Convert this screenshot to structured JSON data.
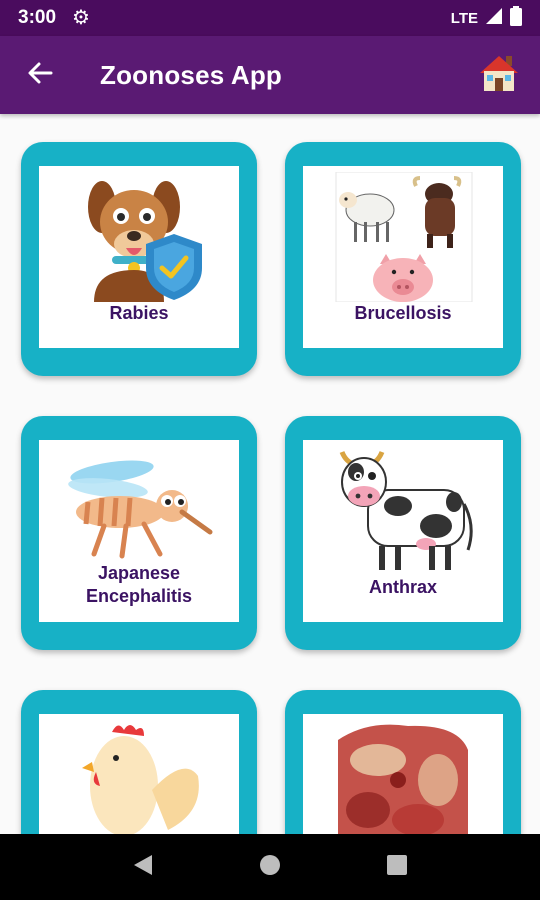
{
  "status_bar": {
    "time": "3:00",
    "network": "LTE",
    "icons": [
      "gear-icon",
      "signal-icon",
      "battery-icon"
    ]
  },
  "app_bar": {
    "title": "Zoonoses App",
    "back_icon": "arrow-left-icon",
    "home_icon": "house-icon"
  },
  "cards": [
    {
      "label": "Rabies",
      "image": "dog-with-shield"
    },
    {
      "label": "Brucellosis",
      "image": "sheep-buffalo-pig"
    },
    {
      "label": "Japanese Encephalitis",
      "image": "mosquito"
    },
    {
      "label": "Anthrax",
      "image": "cow"
    },
    {
      "label": "",
      "image": "chicken"
    },
    {
      "label": "",
      "image": "raw-meat"
    }
  ],
  "nav_bar": {
    "icons": [
      "back-triangle-icon",
      "home-circle-icon",
      "recents-square-icon"
    ]
  },
  "colors": {
    "status_bar": "#4a0c5e",
    "app_bar": "#5a1a73",
    "card_border": "#17b1c6",
    "label": "#3b1363"
  }
}
